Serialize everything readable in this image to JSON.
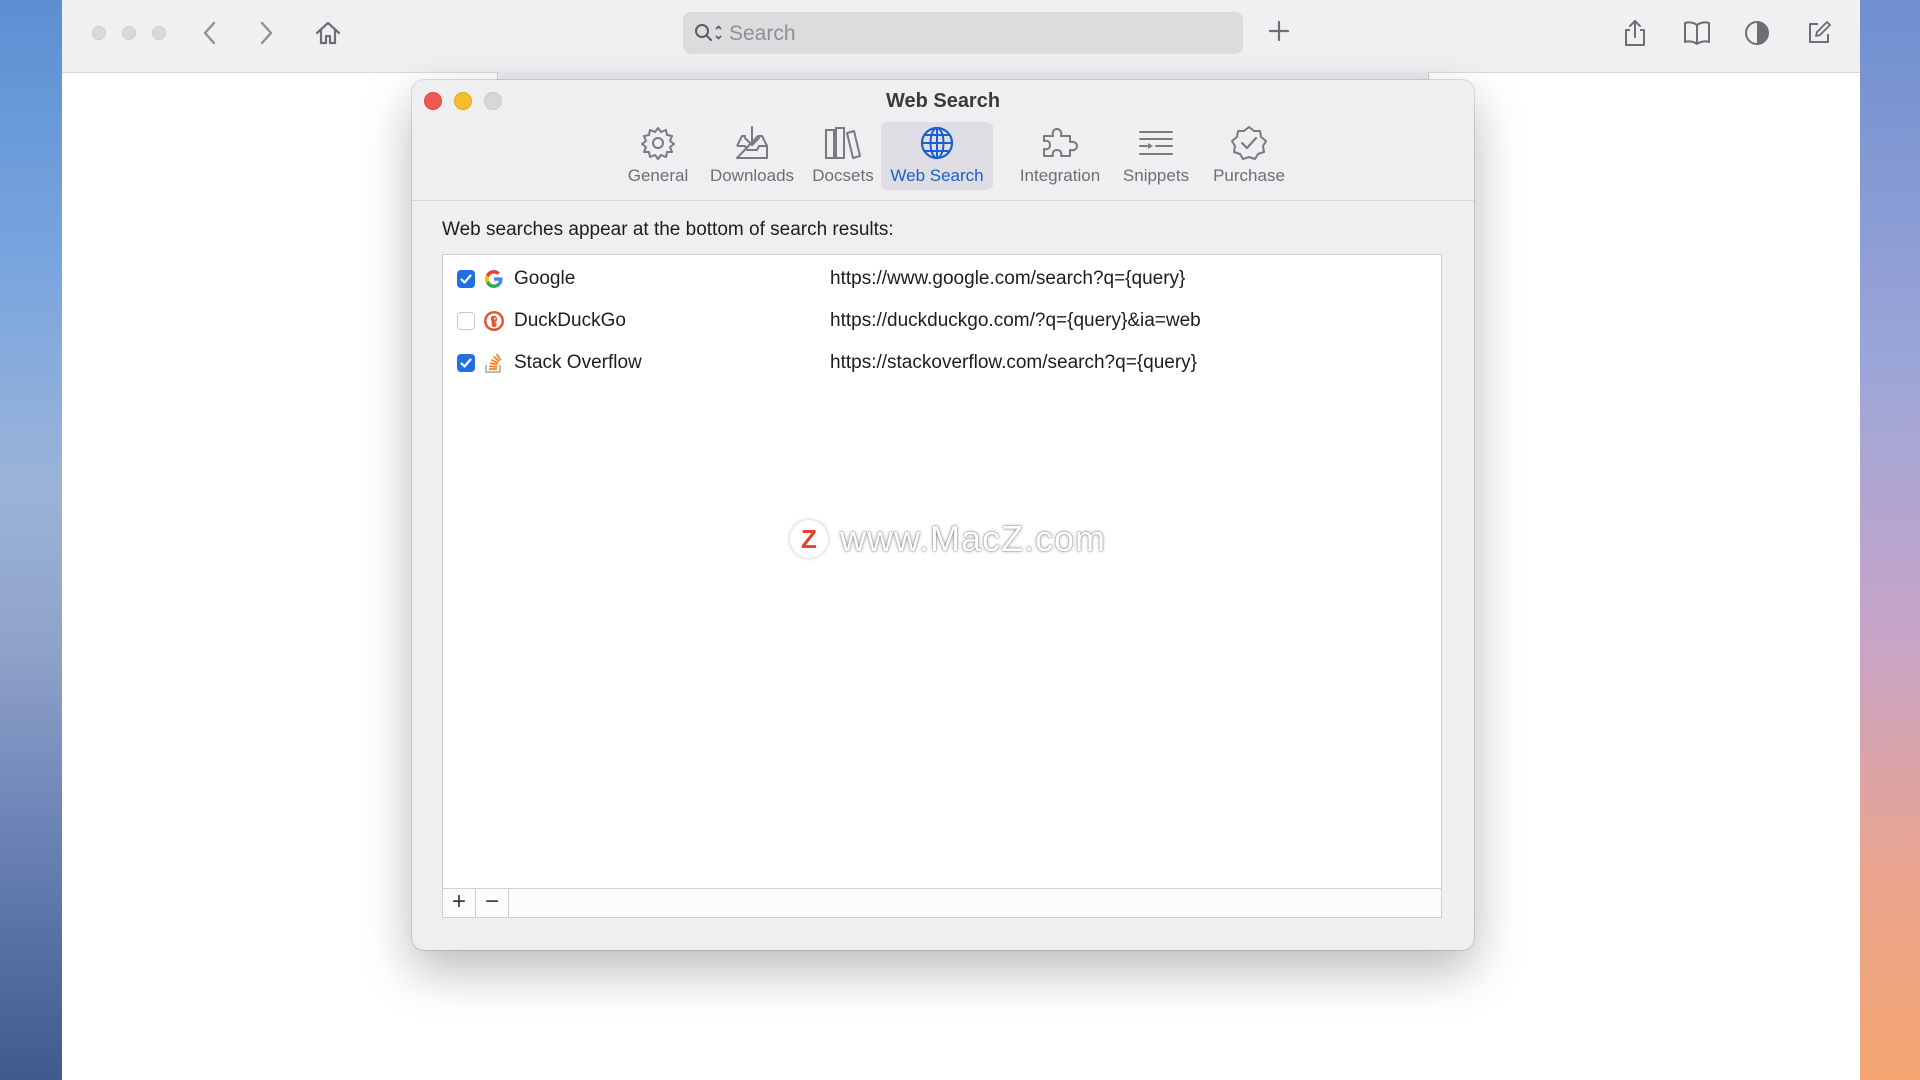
{
  "browser": {
    "search": {
      "placeholder": "Search"
    }
  },
  "dialog": {
    "title": "Web Search",
    "tabs": [
      {
        "label": "General",
        "icon": "gear-icon",
        "active": false
      },
      {
        "label": "Downloads",
        "icon": "tray-download-icon",
        "active": false
      },
      {
        "label": "Docsets",
        "icon": "books-icon",
        "active": false
      },
      {
        "label": "Web Search",
        "icon": "globe-icon",
        "active": true
      },
      {
        "label": "Integration",
        "icon": "puzzle-icon",
        "active": false
      },
      {
        "label": "Snippets",
        "icon": "snippets-icon",
        "active": false
      },
      {
        "label": "Purchase",
        "icon": "checkmark-seal-icon",
        "active": false
      }
    ],
    "intro": "Web searches appear at the bottom of search results:",
    "engines": [
      {
        "name": "Google",
        "url": "https://www.google.com/search?q={query}",
        "enabled": true,
        "icon": "google-icon"
      },
      {
        "name": "DuckDuckGo",
        "url": "https://duckduckgo.com/?q={query}&ia=web",
        "enabled": false,
        "icon": "duckduckgo-icon"
      },
      {
        "name": "Stack Overflow",
        "url": "https://stackoverflow.com/search?q={query}",
        "enabled": true,
        "icon": "stackoverflow-icon"
      }
    ],
    "footer": {
      "add_label": "+",
      "remove_label": "−"
    }
  },
  "watermark": {
    "logo": "Z",
    "text": "www.MacZ.com"
  },
  "colors": {
    "accent": "#1f6fe5",
    "active_tab_text": "#1a5fd0",
    "close": "#ee5a52",
    "minimize": "#f5bd2e"
  }
}
